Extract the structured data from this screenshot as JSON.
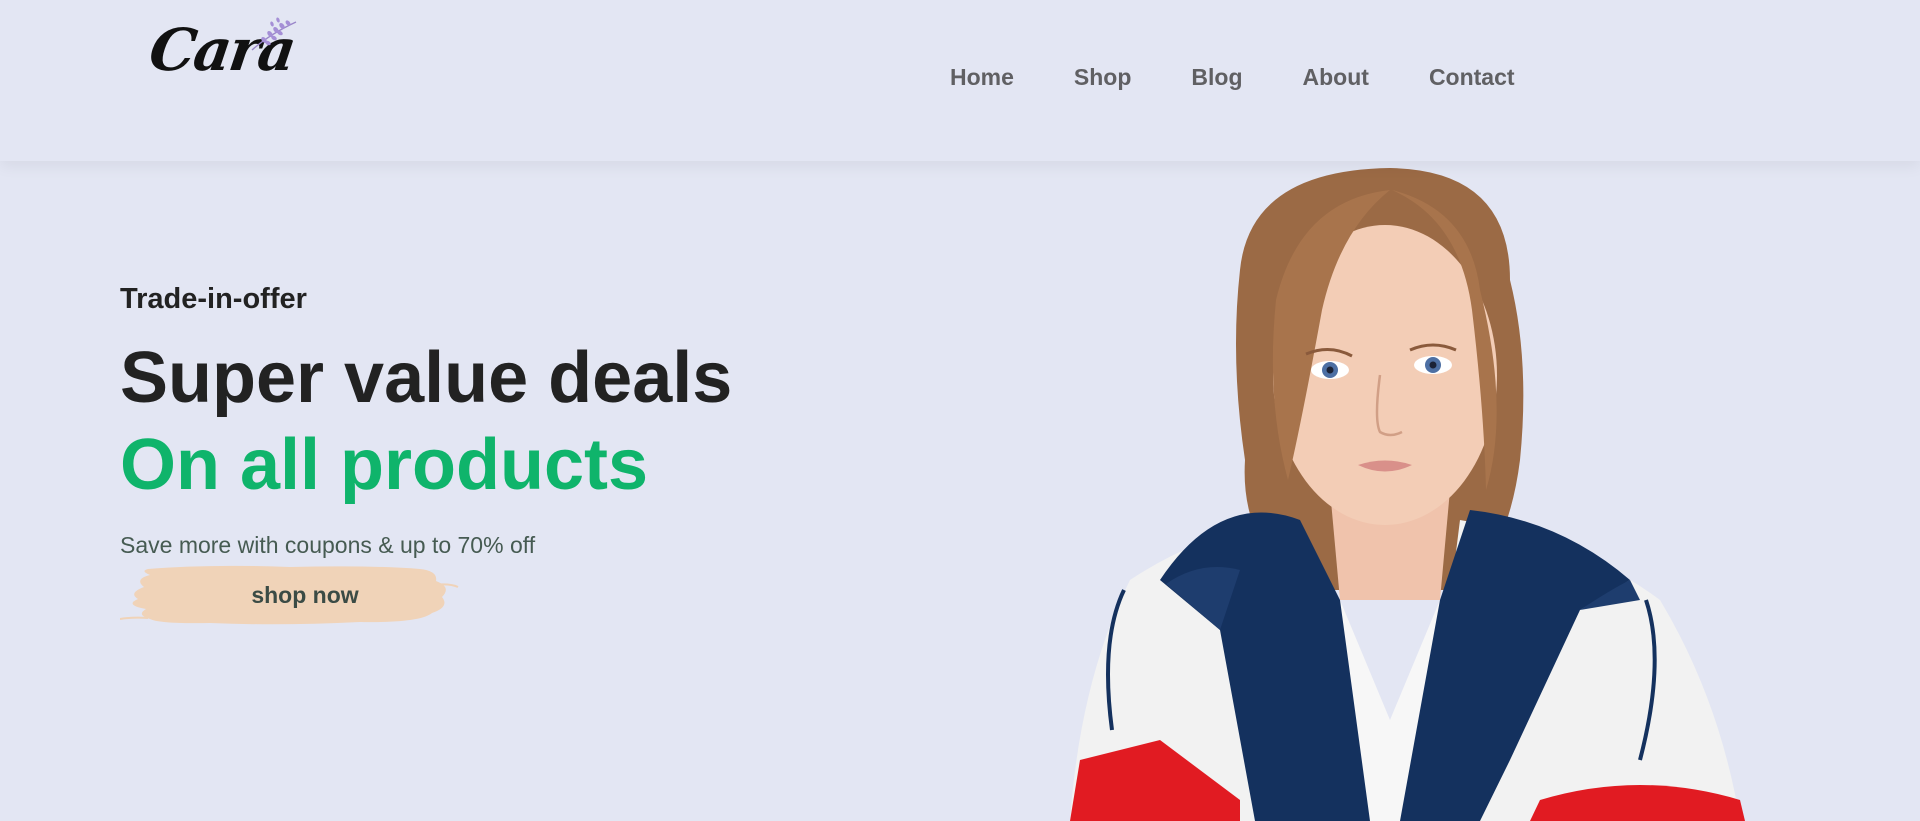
{
  "brand": {
    "logo_text": "Cara"
  },
  "nav": {
    "items": [
      {
        "label": "Home"
      },
      {
        "label": "Shop"
      },
      {
        "label": "Blog"
      },
      {
        "label": "About"
      },
      {
        "label": "Contact"
      }
    ]
  },
  "hero": {
    "eyebrow": "Trade-in-offer",
    "headline_1": "Super value deals",
    "headline_2": "On all products",
    "subtext": "Save more with coupons & up to 70% off",
    "button_label": "shop now",
    "accent_color": "#0fb46b",
    "button_color": "#f0d3b8"
  },
  "colors": {
    "background": "#e3e6f3",
    "nav_text": "#606063",
    "heading": "#222222"
  },
  "icons": {
    "logo_decoration": "lavender-sprig-icon"
  }
}
